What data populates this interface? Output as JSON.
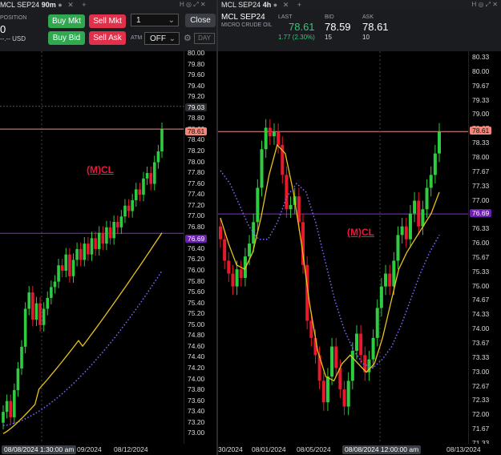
{
  "left": {
    "tab": {
      "symbol": "MCL SEP24",
      "interval": "90m"
    },
    "position_label": "POSITION",
    "position_value": "0",
    "pnl": "--.-- USD",
    "buttons": {
      "buy_mkt": "Buy Mkt",
      "sell_mkt": "Sell Mkt",
      "buy_bid": "Buy Bid",
      "sell_ask": "Sell Ask",
      "close": "Close",
      "day": "DAY"
    },
    "qty": "1",
    "atm_label": "ATM",
    "atm_value": "OFF",
    "study_label": "(M)CL",
    "price_ticks": [
      "80.00",
      "79.80",
      "79.60",
      "79.40",
      "79.20",
      "79.00",
      "78.80",
      "78.60",
      "78.40",
      "78.20",
      "78.00",
      "77.80",
      "77.60",
      "77.40",
      "77.20",
      "77.00",
      "76.80",
      "76.60",
      "76.40",
      "76.20",
      "76.00",
      "75.80",
      "75.60",
      "75.40",
      "75.20",
      "75.00",
      "74.80",
      "74.60",
      "74.40",
      "74.20",
      "74.00",
      "73.80",
      "73.60",
      "73.40",
      "73.20",
      "73.00"
    ],
    "tags": {
      "grey": "79.03",
      "last": "78.61",
      "purple": "76.69"
    },
    "time_labels": {
      "cursor": "08/08/2024 1:30:00 am",
      "t1": "09/2024",
      "t2": "08/12/2024"
    }
  },
  "right": {
    "tab": {
      "symbol": "MCL SEP24",
      "interval": "4h"
    },
    "symbol": "MCL SEP24",
    "description": "MICRO CRUDE OIL",
    "quote": {
      "last_label": "LAST",
      "last": "78.61",
      "change": "1.77 (2.30%)",
      "bid_label": "BID",
      "bid": "78.59",
      "bid_size": "15",
      "ask_label": "ASK",
      "ask": "78.61",
      "ask_size": "10"
    },
    "study_label": "(M)CL",
    "price_ticks": [
      "80.33",
      "80.00",
      "79.67",
      "79.33",
      "79.00",
      "78.67",
      "78.33",
      "78.00",
      "77.67",
      "77.33",
      "77.00",
      "76.67",
      "76.33",
      "76.00",
      "75.67",
      "75.33",
      "75.00",
      "74.67",
      "74.33",
      "74.00",
      "73.67",
      "73.33",
      "73.00",
      "72.67",
      "72.33",
      "72.00",
      "71.67",
      "71.33"
    ],
    "tags": {
      "last": "78.61",
      "purple": "76.69"
    },
    "time_labels": {
      "t0": "30/2024",
      "t1": "08/01/2024",
      "t2": "08/05/2024",
      "cursor": "08/08/2024 12:00:00 am",
      "t3": "08/13/2024"
    }
  },
  "colors": {
    "up": "#2ecc40",
    "down": "#e8192c",
    "ma_fast": "#e8c417",
    "ma_slow": "#7b6cff",
    "last_tag": "#f4877a",
    "purple_line": "#8a2be2"
  }
}
